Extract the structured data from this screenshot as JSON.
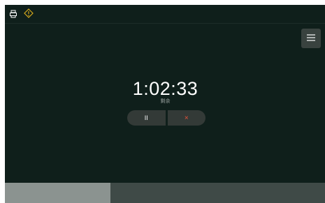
{
  "status_bar": {
    "icons": [
      "printer-icon",
      "warning-diamond-icon"
    ]
  },
  "menu": {
    "icon": "hamburger-menu-icon"
  },
  "timer": {
    "time": "1:02:33",
    "sub_label": "剩余"
  },
  "controls": {
    "pause_label": "II",
    "cancel_label": "×"
  },
  "progress": {
    "fraction": 0.33
  },
  "colors": {
    "background": "#0f1f1b",
    "accent_warning": "#d4a81c",
    "cancel": "#e8533a",
    "progress_done": "#8b9390",
    "progress_rest": "#3f4a47"
  }
}
